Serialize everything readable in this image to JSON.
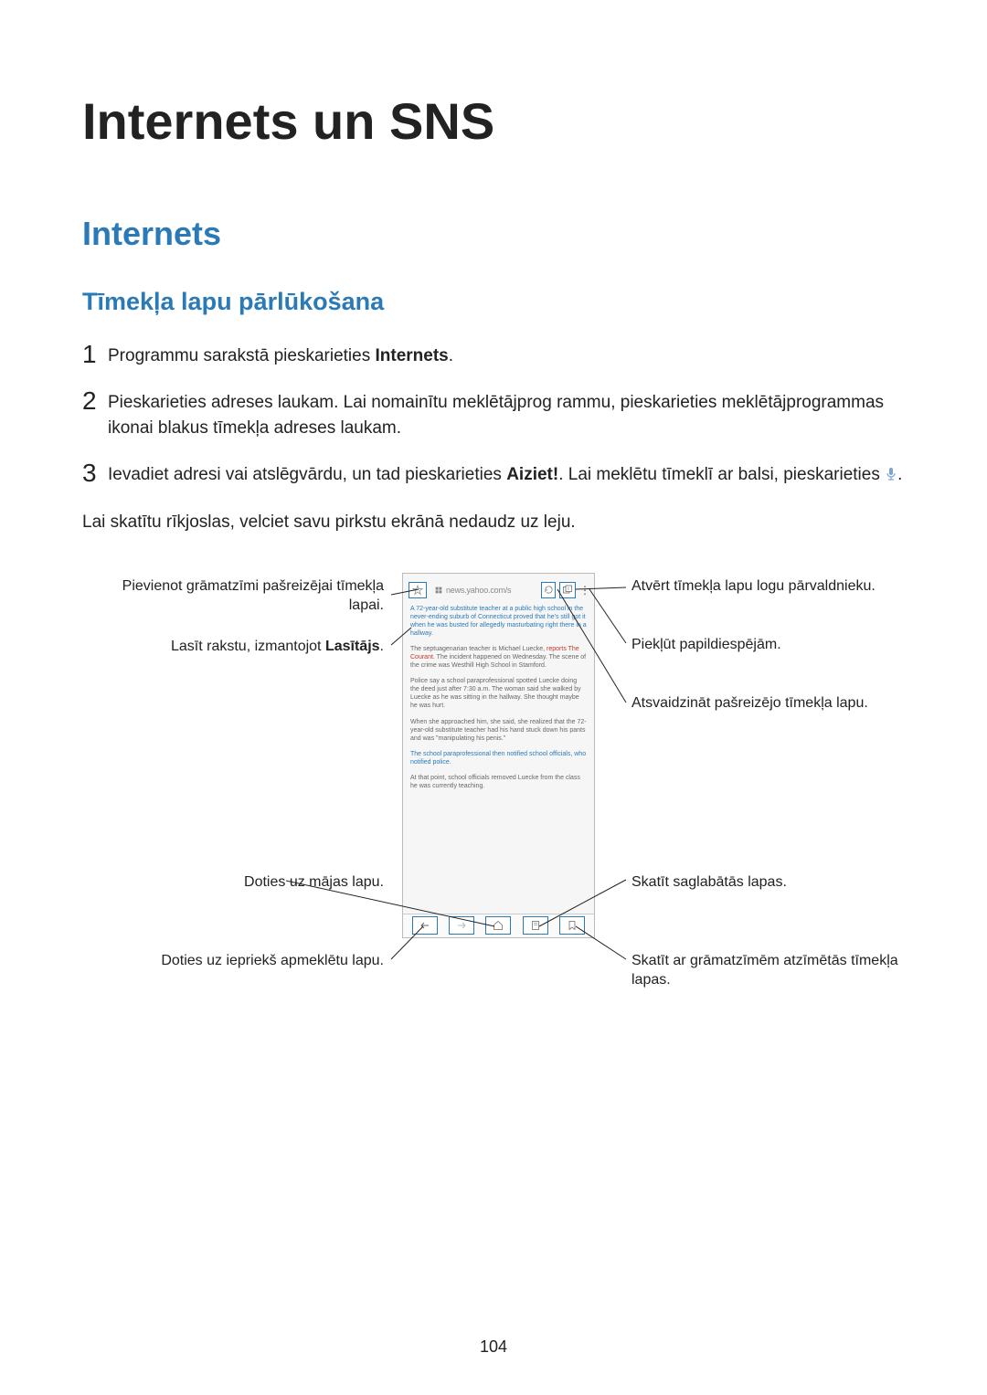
{
  "pageTitle": "Internets un SNS",
  "sectionTitle": "Internets",
  "subsectionTitle": "Tīmekļa lapu pārlūkošana",
  "steps": [
    {
      "num": "1",
      "pre": "Programmu sarakstā pieskarieties ",
      "bold": "Internets",
      "post": "."
    },
    {
      "num": "2",
      "pre": "Pieskarieties adreses laukam. Lai nomainītu meklētājprog rammu, pieskarieties meklētājprogrammas ikonai blakus tīmekļa adreses laukam.",
      "bold": "",
      "post": ""
    },
    {
      "num": "3",
      "pre": "Ievadiet adresi vai atslēgvārdu, un tad pieskarieties ",
      "bold": "Aiziet!",
      "post": ". Lai meklētu tīmeklī ar balsi, pieskarieties "
    }
  ],
  "afterSteps": "Lai skatītu rīkjoslas, velciet savu pirkstu ekrānā nedaudz uz leju.",
  "callouts": {
    "leftTop1": "Pievienot grāmatzīmi pašreizējai tīmekļa lapai.",
    "leftReader_pre": "Lasīt rakstu, izmantojot ",
    "leftReader_bold": "Lasītājs",
    "leftReader_post": ".",
    "leftHome": "Doties uz mājas lapu.",
    "leftBack": "Doties uz iepriekš apmeklētu lapu.",
    "rightWindows": "Atvērt tīmekļa lapu logu pārvaldnieku.",
    "rightMore": "Piekļūt papildiespējām.",
    "rightRefresh": "Atsvaidzināt pašreizējo tīmekļa lapu.",
    "rightSaved": "Skatīt saglabātās lapas.",
    "rightBookmarks": "Skatīt ar grāmatzīmēm atzīmētās tīmekļa lapas."
  },
  "urlBarText": "news.yahoo.com/s",
  "article": {
    "p1a": "A 72-year-old substitute teacher at a public high school in the never-ending suburb of Connecticut proved that he's still got it when he was busted for allegedly masturbating right there in a hallway.",
    "p2a": "The septuagenarian teacher is Michael Luecke,",
    "p2b": " reports The Courant.",
    "p2c": " The incident happened on Wednesday. The scene of the crime was Westhill High School in Stamford.",
    "p3": "Police say a school paraprofessional spotted Luecke doing the deed just after 7:30 a.m. The woman said she walked by Luecke as he was sitting in the hallway. She thought maybe he was hurt.",
    "p4": "When she approached him, she said, she realized that the 72-year-old substitute teacher had his hand stuck down his pants and was \"manipulating his penis.\"",
    "p5": "The school paraprofessional then notified school officials, who notified police.",
    "p6": "At that point, school officials removed Luecke from the class he was currently teaching."
  },
  "pageNumber": "104"
}
